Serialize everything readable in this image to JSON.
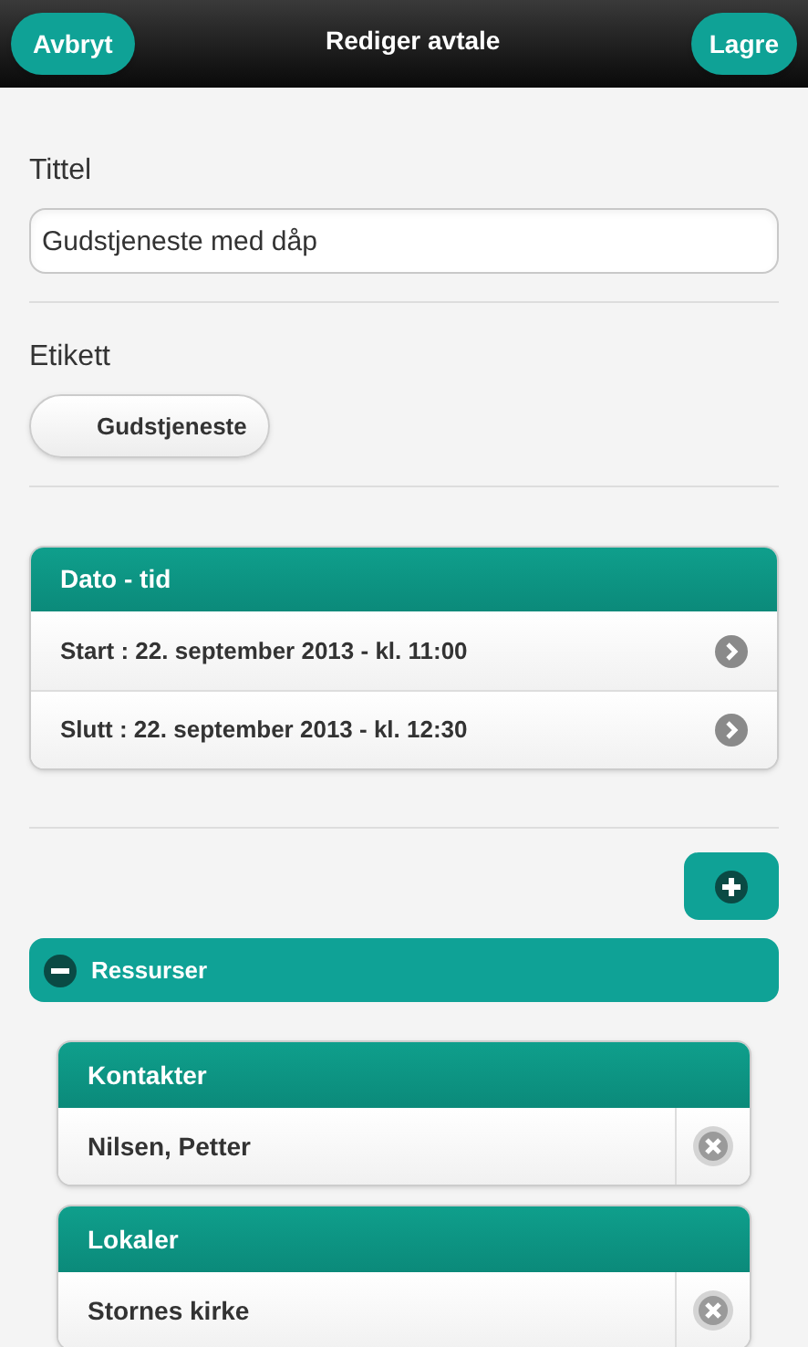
{
  "header": {
    "title": "Rediger avtale",
    "left_button": "Avbryt",
    "right_button": "Lagre"
  },
  "title_field": {
    "label": "Tittel",
    "value": "Gudstjeneste med dåp"
  },
  "tag_field": {
    "label": "Etikett",
    "value": "Gudstjeneste"
  },
  "date_card": {
    "title": "Dato - tid",
    "rows": [
      {
        "text": "Start : 22. september 2013 - kl. 11:00"
      },
      {
        "text": "Slutt : 22. september 2013 - kl. 12:30"
      }
    ]
  },
  "resources": {
    "title": "Ressurser",
    "expanded": true,
    "groups": [
      {
        "title": "Kontakter",
        "items": [
          {
            "text": "Nilsen, Petter"
          }
        ]
      },
      {
        "title": "Lokaler",
        "items": [
          {
            "text": "Stornes kirke"
          }
        ]
      }
    ]
  }
}
